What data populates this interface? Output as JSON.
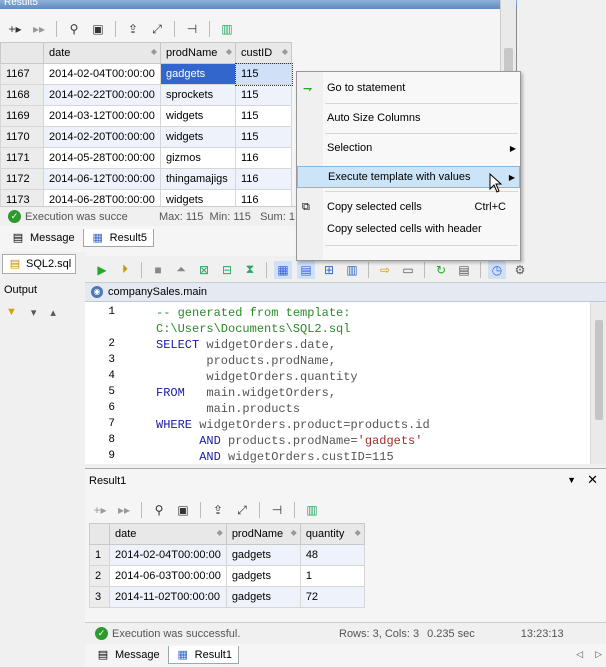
{
  "top_panel": {
    "title": "Result5",
    "columns": [
      "date",
      "prodName",
      "custID"
    ],
    "rows": [
      {
        "n": "1167",
        "date": "2014-02-04T00:00:00",
        "prodName": "gadgets",
        "custID": "115"
      },
      {
        "n": "1168",
        "date": "2014-02-22T00:00:00",
        "prodName": "sprockets",
        "custID": "115"
      },
      {
        "n": "1169",
        "date": "2014-03-12T00:00:00",
        "prodName": "widgets",
        "custID": "115"
      },
      {
        "n": "1170",
        "date": "2014-02-20T00:00:00",
        "prodName": "widgets",
        "custID": "115"
      },
      {
        "n": "1171",
        "date": "2014-05-28T00:00:00",
        "prodName": "gizmos",
        "custID": "116"
      },
      {
        "n": "1172",
        "date": "2014-06-12T00:00:00",
        "prodName": "thingamajigs",
        "custID": "116"
      },
      {
        "n": "1173",
        "date": "2014-06-28T00:00:00",
        "prodName": "widgets",
        "custID": "116"
      }
    ],
    "status": "Execution was succe",
    "stats": "Max: 115  Min: 115   Sum: 1",
    "tabs": [
      "Message",
      "Result5"
    ]
  },
  "context_menu": {
    "items": [
      {
        "label": "Go to statement",
        "shortcut": ""
      },
      {
        "label": "Auto Size Columns",
        "shortcut": ""
      },
      {
        "label": "Selection",
        "shortcut": ""
      },
      {
        "label": "Execute template with values",
        "shortcut": ""
      },
      {
        "label": "Copy selected cells",
        "shortcut": "Ctrl+C"
      },
      {
        "label": "Copy selected cells with header",
        "shortcut": ""
      }
    ]
  },
  "left_pane": {
    "tab1": "SQL2.sql",
    "output_label": "Output"
  },
  "editor": {
    "title": "companySales.main",
    "lines": [
      {
        "n": "1",
        "parts": [
          [
            "cm",
            "-- generated from template:"
          ]
        ]
      },
      {
        "n": "",
        "parts": [
          [
            "cm",
            "C:\\Users\\Documents\\SQL2.sql"
          ]
        ]
      },
      {
        "n": "2",
        "parts": [
          [
            "kw",
            "SELECT "
          ],
          [
            "id",
            "widgetOrders.date,"
          ]
        ]
      },
      {
        "n": "3",
        "parts": [
          [
            "id",
            "       products.prodName,"
          ]
        ]
      },
      {
        "n": "4",
        "parts": [
          [
            "id",
            "       widgetOrders.quantity"
          ]
        ]
      },
      {
        "n": "5",
        "parts": [
          [
            "kw",
            "FROM   "
          ],
          [
            "id",
            "main.widgetOrders,"
          ]
        ]
      },
      {
        "n": "6",
        "parts": [
          [
            "id",
            "       main.products"
          ]
        ]
      },
      {
        "n": "7",
        "parts": [
          [
            "kw",
            "WHERE "
          ],
          [
            "id",
            "widgetOrders.product=products.id"
          ]
        ]
      },
      {
        "n": "8",
        "parts": [
          [
            "kw",
            "      AND "
          ],
          [
            "id",
            "products.prodName="
          ],
          [
            "str",
            "'gadgets'"
          ]
        ]
      },
      {
        "n": "9",
        "parts": [
          [
            "kw",
            "      AND "
          ],
          [
            "id",
            "widgetOrders.custID=115"
          ]
        ]
      }
    ]
  },
  "bottom_panel": {
    "title": "Result1",
    "columns": [
      "date",
      "prodName",
      "quantity"
    ],
    "rows": [
      {
        "n": "1",
        "date": "2014-02-04T00:00:00",
        "prodName": "gadgets",
        "quantity": "48"
      },
      {
        "n": "2",
        "date": "2014-06-03T00:00:00",
        "prodName": "gadgets",
        "quantity": "1"
      },
      {
        "n": "3",
        "date": "2014-11-02T00:00:00",
        "prodName": "gadgets",
        "quantity": "72"
      }
    ],
    "status": "Execution was successful.",
    "rows_cols": "Rows: 3, Cols: 3",
    "time": "0.235 sec",
    "clock": "13:23:13",
    "tabs": [
      "Message",
      "Result1"
    ]
  }
}
